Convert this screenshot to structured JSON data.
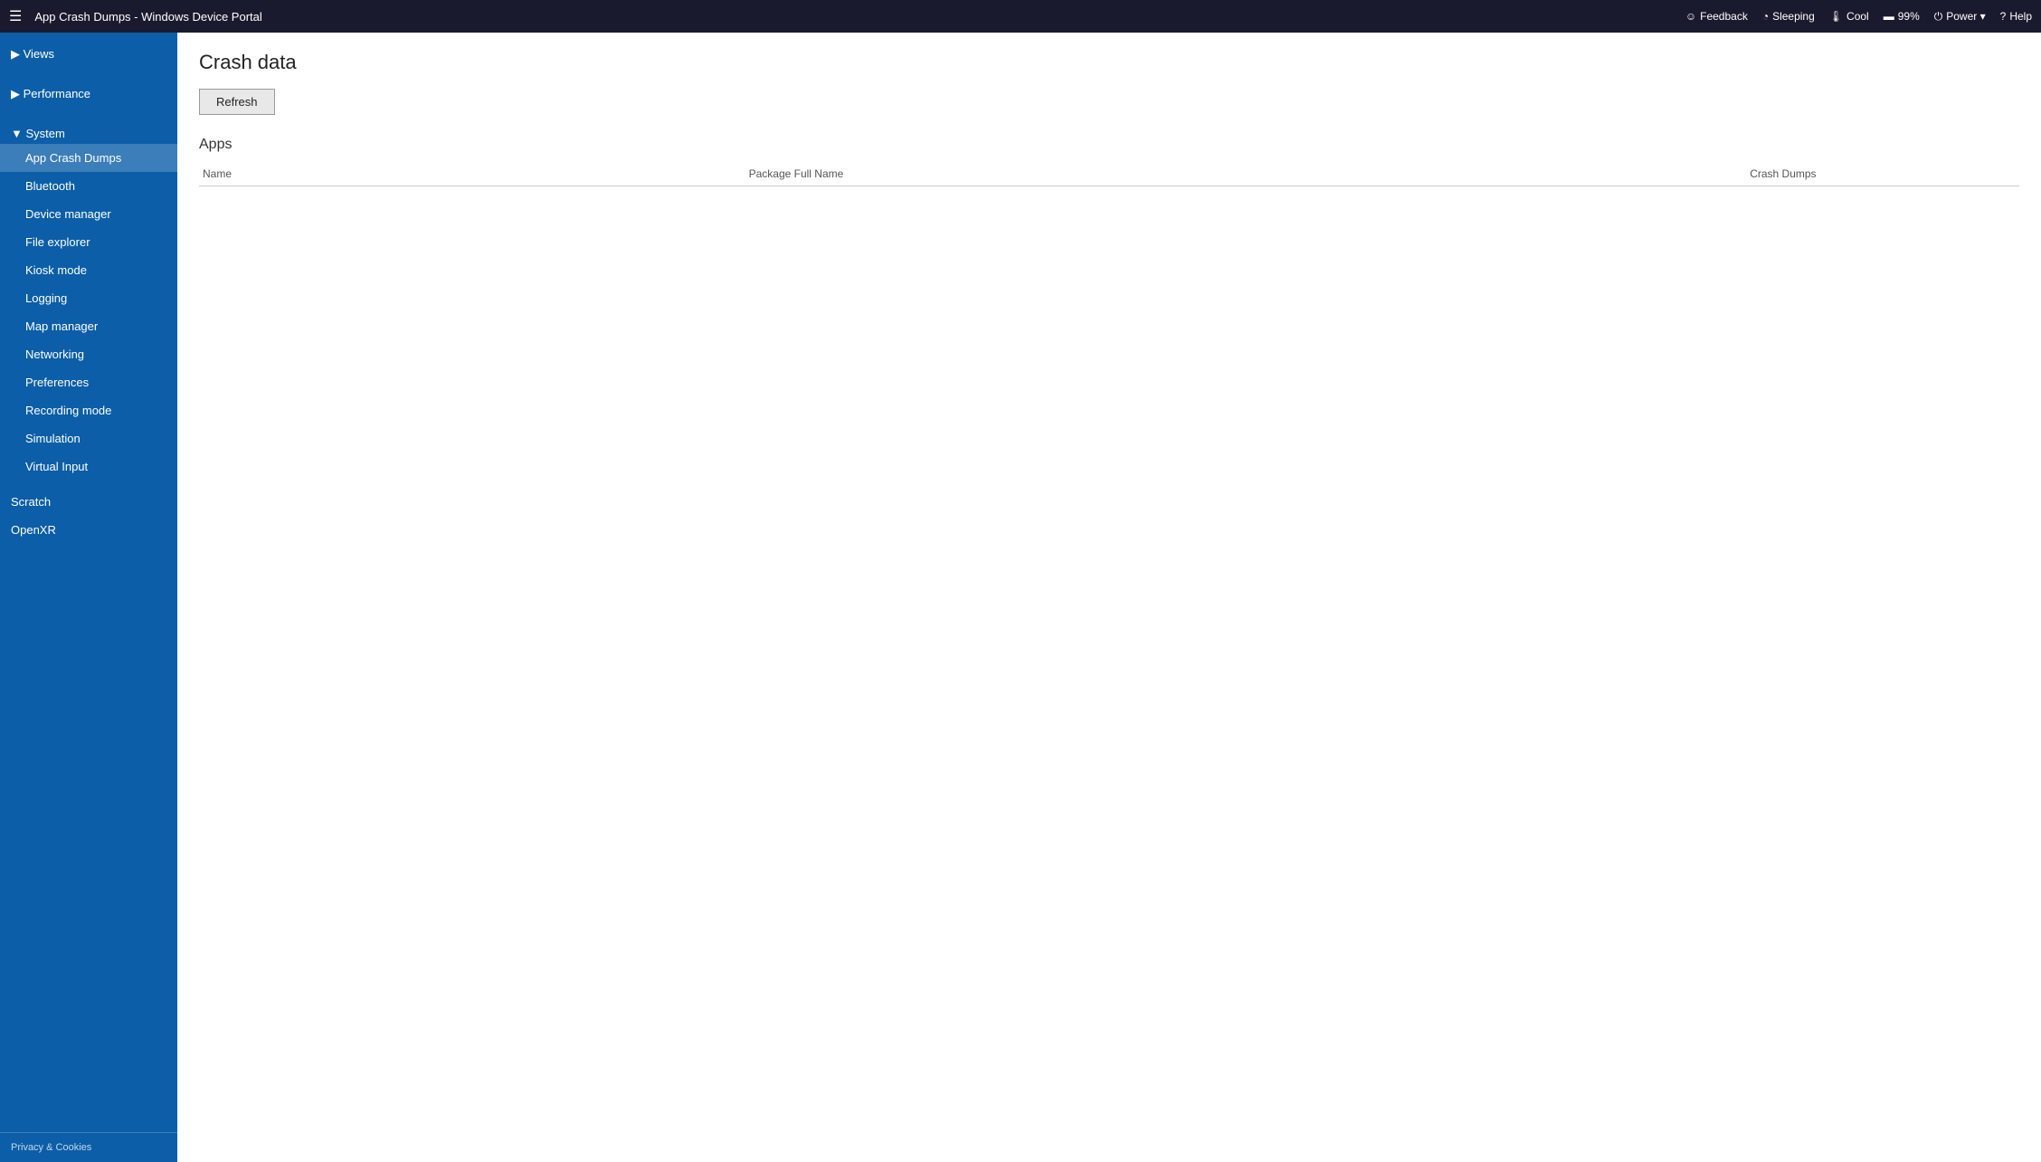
{
  "topbar": {
    "hamburger": "☰",
    "title": "App Crash Dumps - Windows Device Portal",
    "status": {
      "feedback_icon": "☺",
      "feedback_label": "Feedback",
      "sleep_icon": "◔",
      "sleep_label": "Sleeping",
      "temp_icon": "🌡",
      "temp_label": "Cool",
      "battery_icon": "▬",
      "battery_label": "99%",
      "power_icon": "⏻",
      "power_label": "Power ▾",
      "help_icon": "?",
      "help_label": "Help"
    }
  },
  "sidebar": {
    "collapse_icon": "◀",
    "views_label": "▶ Views",
    "performance_label": "▶ Performance",
    "system_label": "▼ System",
    "system_items": [
      {
        "id": "app-crash-dumps",
        "label": "App Crash Dumps",
        "active": true
      },
      {
        "id": "bluetooth",
        "label": "Bluetooth",
        "active": false
      },
      {
        "id": "device-manager",
        "label": "Device manager",
        "active": false
      },
      {
        "id": "file-explorer",
        "label": "File explorer",
        "active": false
      },
      {
        "id": "kiosk-mode",
        "label": "Kiosk mode",
        "active": false
      },
      {
        "id": "logging",
        "label": "Logging",
        "active": false
      },
      {
        "id": "map-manager",
        "label": "Map manager",
        "active": false
      },
      {
        "id": "networking",
        "label": "Networking",
        "active": false
      },
      {
        "id": "preferences",
        "label": "Preferences",
        "active": false
      },
      {
        "id": "recording-mode",
        "label": "Recording mode",
        "active": false
      },
      {
        "id": "simulation",
        "label": "Simulation",
        "active": false
      },
      {
        "id": "virtual-input",
        "label": "Virtual Input",
        "active": false
      }
    ],
    "scratch_label": "Scratch",
    "openxr_label": "OpenXR",
    "footer_label": "Privacy & Cookies"
  },
  "content": {
    "page_title": "Crash data",
    "refresh_button": "Refresh",
    "apps_section_title": "Apps",
    "table_headers": {
      "name": "Name",
      "package_full_name": "Package Full Name",
      "crash_dumps": "Crash Dumps"
    },
    "table_rows": []
  }
}
